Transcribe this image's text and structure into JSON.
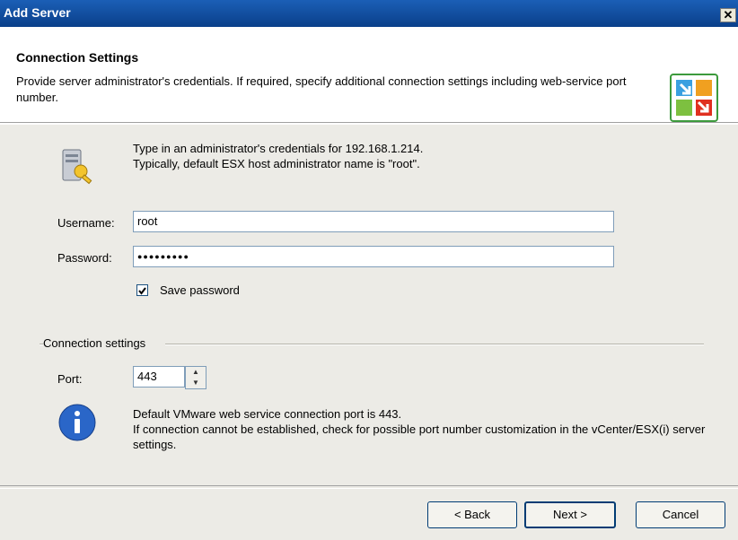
{
  "window": {
    "title": "Add Server",
    "close_glyph": "✕"
  },
  "header": {
    "title": "Connection Settings",
    "description": "Provide server administrator's credentials. If required, specify additional connection settings including web-service port number.",
    "logo_icon": "server-wizard-logo-icon"
  },
  "credentials": {
    "intro_line1": "Type in an administrator's credentials for 192.168.1.214.",
    "intro_line2": "Typically, default ESX host administrator name is \"root\".",
    "username_label": "Username:",
    "username_value": "root",
    "password_label": "Password:",
    "password_value": "●●●●●●●●●",
    "save_password_label": "Save password",
    "save_password_checked": true
  },
  "connection": {
    "group_label": "Connection settings",
    "port_label": "Port:",
    "port_value": "443",
    "info_line1": "Default VMware web service connection port is 443.",
    "info_line2": "If connection cannot be established, check for possible port number customization in the vCenter/ESX(i) server settings."
  },
  "buttons": {
    "back": "< Back",
    "next": "Next >",
    "cancel": "Cancel"
  }
}
